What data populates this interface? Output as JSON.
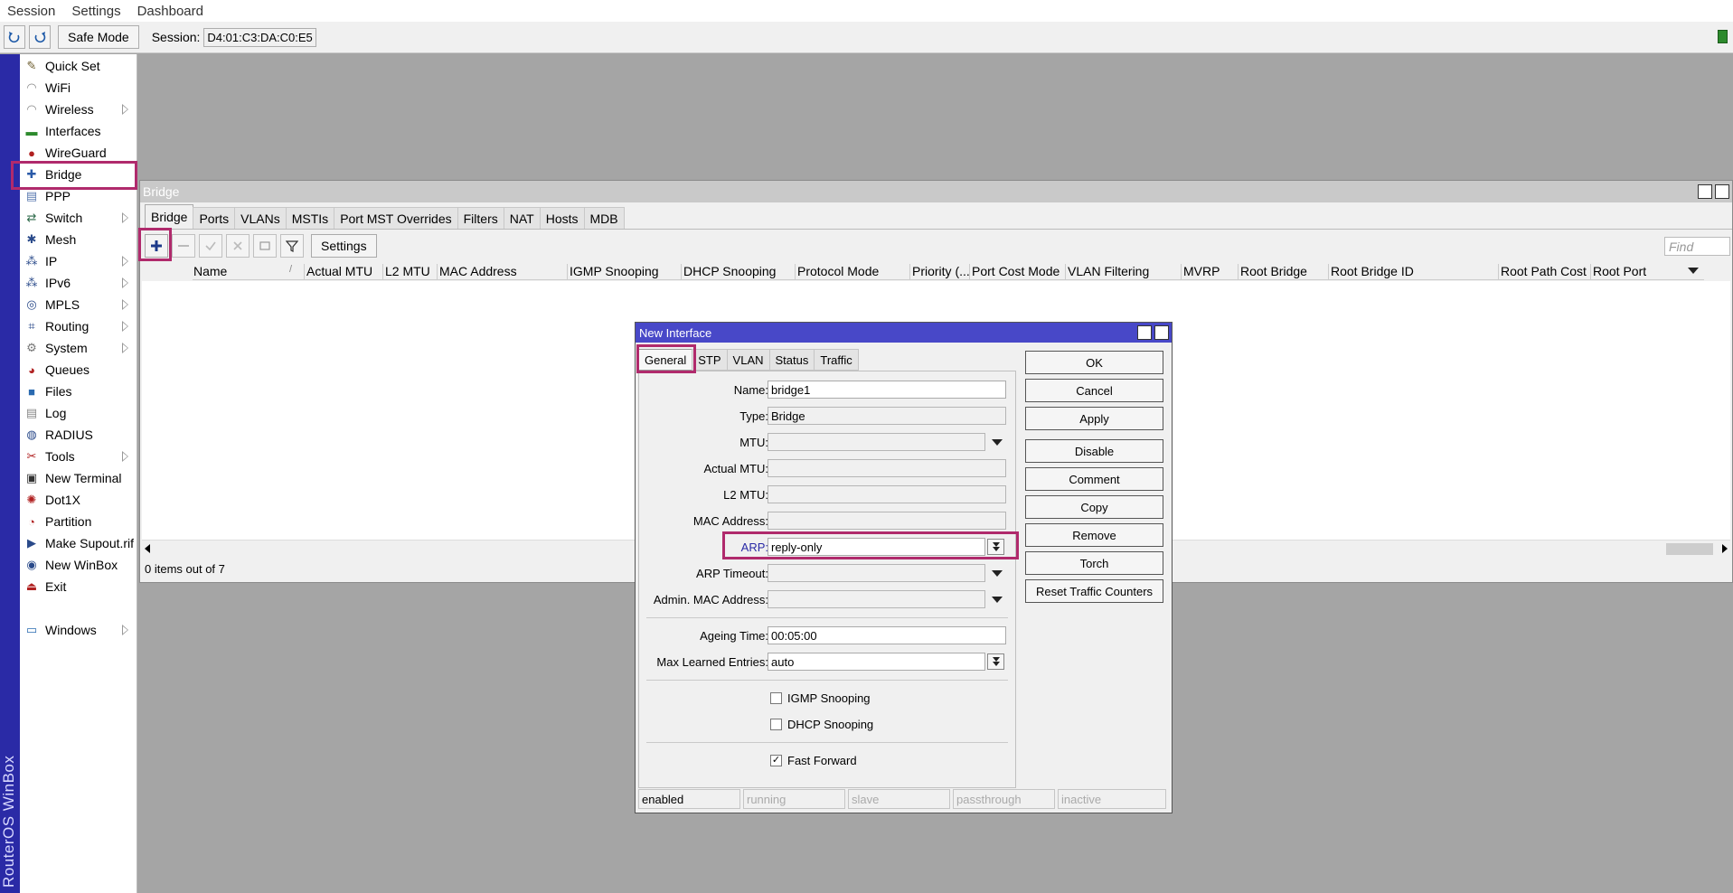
{
  "menubar": {
    "items": [
      "Session",
      "Settings",
      "Dashboard"
    ]
  },
  "toolbar": {
    "undo_icon": "undo-icon",
    "redo_icon": "redo-icon",
    "safe_mode": "Safe Mode",
    "session_label": "Session:",
    "session_value": "D4:01:C3:DA:C0:E5",
    "indicator_color": "#2d8a2d"
  },
  "brand": "RouterOS WinBox",
  "sidebar": {
    "items": [
      {
        "label": "Quick Set",
        "icon": "wand-icon",
        "glyph": "✎",
        "color": "#6a5a2a",
        "submenu": false
      },
      {
        "label": "WiFi",
        "icon": "wifi-icon",
        "glyph": "◠",
        "color": "#888",
        "submenu": false
      },
      {
        "label": "Wireless",
        "icon": "antenna-icon",
        "glyph": "◠",
        "color": "#888",
        "submenu": true
      },
      {
        "label": "Interfaces",
        "icon": "interfaces-icon",
        "glyph": "▬",
        "color": "#2d8a2d",
        "submenu": false
      },
      {
        "label": "WireGuard",
        "icon": "wireguard-icon",
        "glyph": "●",
        "color": "#b02020",
        "submenu": false
      },
      {
        "label": "Bridge",
        "icon": "bridge-icon",
        "glyph": "✚",
        "color": "#2a5aa8",
        "submenu": false
      },
      {
        "label": "PPP",
        "icon": "ppp-icon",
        "glyph": "▤",
        "color": "#5a7ab0",
        "submenu": false
      },
      {
        "label": "Switch",
        "icon": "switch-icon",
        "glyph": "⇄",
        "color": "#2d6a4a",
        "submenu": true
      },
      {
        "label": "Mesh",
        "icon": "mesh-icon",
        "glyph": "✱",
        "color": "#2a4a8a",
        "submenu": false
      },
      {
        "label": "IP",
        "icon": "ip-icon",
        "glyph": "⁂",
        "color": "#2a4a8a",
        "submenu": true
      },
      {
        "label": "IPv6",
        "icon": "ipv6-icon",
        "glyph": "⁂",
        "color": "#2a4a8a",
        "submenu": true
      },
      {
        "label": "MPLS",
        "icon": "mpls-icon",
        "glyph": "◎",
        "color": "#2a4a8a",
        "submenu": true
      },
      {
        "label": "Routing",
        "icon": "routing-icon",
        "glyph": "⌗",
        "color": "#2a4a8a",
        "submenu": true
      },
      {
        "label": "System",
        "icon": "system-gear-icon",
        "glyph": "⚙",
        "color": "#777",
        "submenu": true
      },
      {
        "label": "Queues",
        "icon": "queues-icon",
        "glyph": "◕",
        "color": "#b02020",
        "submenu": false
      },
      {
        "label": "Files",
        "icon": "folder-icon",
        "glyph": "■",
        "color": "#2a6ab0",
        "submenu": false
      },
      {
        "label": "Log",
        "icon": "log-icon",
        "glyph": "▤",
        "color": "#888",
        "submenu": false
      },
      {
        "label": "RADIUS",
        "icon": "radius-icon",
        "glyph": "◍",
        "color": "#2a4a8a",
        "submenu": false
      },
      {
        "label": "Tools",
        "icon": "tools-icon",
        "glyph": "✂",
        "color": "#b02020",
        "submenu": true
      },
      {
        "label": "New Terminal",
        "icon": "terminal-icon",
        "glyph": "▣",
        "color": "#333",
        "submenu": false
      },
      {
        "label": "Dot1X",
        "icon": "dot1x-icon",
        "glyph": "✺",
        "color": "#b02020",
        "submenu": false
      },
      {
        "label": "Partition",
        "icon": "partition-icon",
        "glyph": "◔",
        "color": "#b02020",
        "submenu": false
      },
      {
        "label": "Make Supout.rif",
        "icon": "supout-icon",
        "glyph": "▶",
        "color": "#2a4a8a",
        "submenu": false
      },
      {
        "label": "New WinBox",
        "icon": "winbox-icon",
        "glyph": "◉",
        "color": "#2a4a8a",
        "submenu": false
      },
      {
        "label": "Exit",
        "icon": "exit-icon",
        "glyph": "⏏",
        "color": "#b02020",
        "submenu": false
      },
      {
        "label": "Windows",
        "icon": "windows-icon",
        "glyph": "▭",
        "color": "#2a6ab0",
        "submenu": true
      }
    ]
  },
  "bridge_window": {
    "title": "Bridge",
    "tabs": [
      "Bridge",
      "Ports",
      "VLANs",
      "MSTIs",
      "Port MST Overrides",
      "Filters",
      "NAT",
      "Hosts",
      "MDB"
    ],
    "settings_label": "Settings",
    "find_placeholder": "Find",
    "columns": [
      "Name",
      "Actual MTU",
      "L2 MTU",
      "MAC Address",
      "IGMP Snooping",
      "DHCP Snooping",
      "Protocol Mode",
      "Priority (...",
      "Port Cost Mode",
      "VLAN Filtering",
      "MVRP",
      "Root Bridge",
      "Root Bridge ID",
      "Root Path Cost",
      "Root Port"
    ],
    "status": "0 items out of 7"
  },
  "dialog": {
    "title": "New Interface",
    "tabs": [
      "General",
      "STP",
      "VLAN",
      "Status",
      "Traffic"
    ],
    "fields": {
      "name": {
        "label": "Name:",
        "value": "bridge1"
      },
      "type": {
        "label": "Type:",
        "value": "Bridge"
      },
      "mtu": {
        "label": "MTU:",
        "value": ""
      },
      "actual_mtu": {
        "label": "Actual MTU:",
        "value": ""
      },
      "l2_mtu": {
        "label": "L2 MTU:",
        "value": ""
      },
      "mac_address": {
        "label": "MAC Address:",
        "value": ""
      },
      "arp": {
        "label": "ARP:",
        "value": "reply-only"
      },
      "arp_timeout": {
        "label": "ARP Timeout:",
        "value": ""
      },
      "admin_mac": {
        "label": "Admin. MAC Address:",
        "value": ""
      },
      "ageing_time": {
        "label": "Ageing Time:",
        "value": "00:05:00"
      },
      "max_learned": {
        "label": "Max Learned Entries:",
        "value": "auto"
      }
    },
    "checkboxes": {
      "igmp": {
        "label": "IGMP Snooping",
        "checked": false
      },
      "dhcp": {
        "label": "DHCP Snooping",
        "checked": false
      },
      "fast_forward": {
        "label": "Fast Forward",
        "checked": true
      }
    },
    "buttons": [
      "OK",
      "Cancel",
      "Apply",
      "Disable",
      "Comment",
      "Copy",
      "Remove",
      "Torch",
      "Reset Traffic Counters"
    ],
    "status": [
      "enabled",
      "running",
      "slave",
      "passthrough",
      "inactive"
    ]
  },
  "colors": {
    "highlight": "#b02a6c",
    "dialog_title": "#4848c8",
    "brand_strip": "#2a2aa6"
  }
}
